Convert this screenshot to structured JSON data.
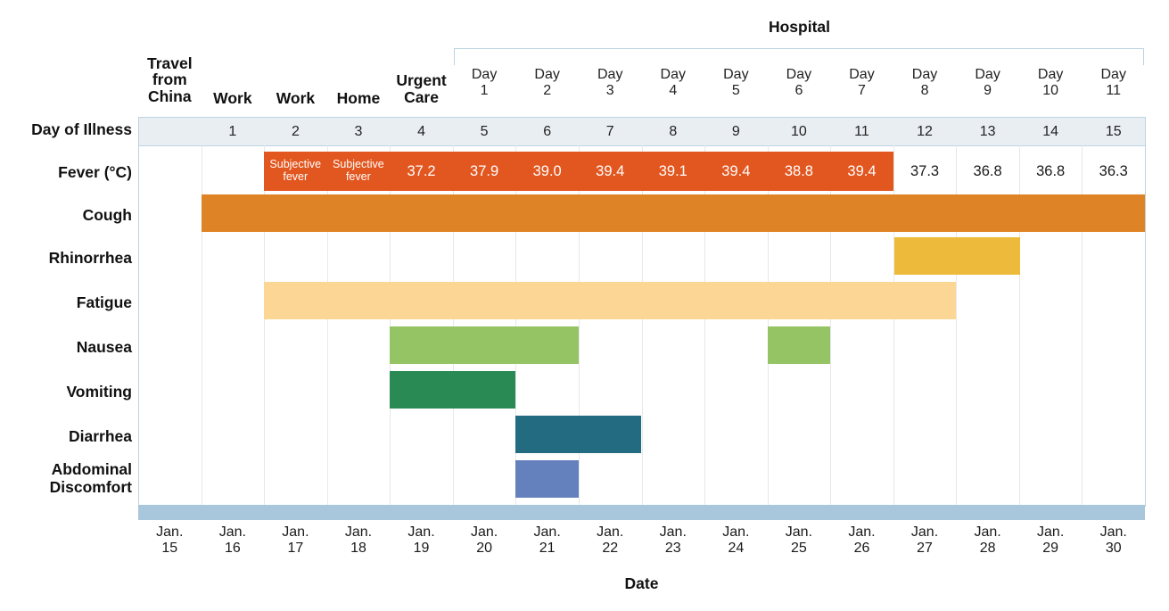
{
  "figure": {
    "hospital_label": "Hospital",
    "day_of_illness_label": "Day of Illness",
    "axis_title": "Date"
  },
  "setting_headers": [
    {
      "label": "Travel\nfrom\nChina",
      "col": 0
    },
    {
      "label": "Work",
      "col": 1
    },
    {
      "label": "Work",
      "col": 2
    },
    {
      "label": "Home",
      "col": 3
    },
    {
      "label": "Urgent\nCare",
      "col": 4
    }
  ],
  "hospital_days": [
    "Day\n1",
    "Day\n2",
    "Day\n3",
    "Day\n4",
    "Day\n5",
    "Day\n6",
    "Day\n7",
    "Day\n8",
    "Day\n9",
    "Day\n10",
    "Day\n11"
  ],
  "day_of_illness": [
    "",
    "1",
    "2",
    "3",
    "4",
    "5",
    "6",
    "7",
    "8",
    "9",
    "10",
    "11",
    "12",
    "13",
    "14",
    "15"
  ],
  "dates": [
    "Jan.\n15",
    "Jan.\n16",
    "Jan.\n17",
    "Jan.\n18",
    "Jan.\n19",
    "Jan.\n20",
    "Jan.\n21",
    "Jan.\n22",
    "Jan.\n23",
    "Jan.\n24",
    "Jan.\n25",
    "Jan.\n26",
    "Jan.\n27",
    "Jan.\n28",
    "Jan.\n29",
    "Jan.\n30"
  ],
  "row_labels": {
    "fever": "Fever (°C)",
    "cough": "Cough",
    "rhinorrhea": "Rhinorrhea",
    "fatigue": "Fatigue",
    "nausea": "Nausea",
    "vomiting": "Vomiting",
    "diarrhea": "Diarrhea",
    "abdominal": "Abdominal\nDiscomfort"
  },
  "colors": {
    "fever_bar": "#e2561f",
    "cough_bar": "#df8426",
    "rhinorrhea_bar": "#eeba3c",
    "fatigue_bar": "#fcd695",
    "nausea_bar": "#95c464",
    "vomiting_bar": "#2a8a54",
    "diarrhea_bar": "#226b80",
    "abdominal_bar": "#6481bd",
    "strip_blue": "#a8c6dc",
    "doi_strip": "#e9eef3",
    "rule": "#bcd3e2"
  },
  "chart_data": {
    "type": "table",
    "title": "Clinical course of illness by day",
    "xlabel": "Date",
    "ylabel": "",
    "categories": [
      "Jan. 15",
      "Jan. 16",
      "Jan. 17",
      "Jan. 18",
      "Jan. 19",
      "Jan. 20",
      "Jan. 21",
      "Jan. 22",
      "Jan. 23",
      "Jan. 24",
      "Jan. 25",
      "Jan. 26",
      "Jan. 27",
      "Jan. 28",
      "Jan. 29",
      "Jan. 30"
    ],
    "day_of_illness": [
      null,
      1,
      2,
      3,
      4,
      5,
      6,
      7,
      8,
      9,
      10,
      11,
      12,
      13,
      14,
      15
    ],
    "setting": [
      "Travel from China",
      "Work",
      "Work",
      "Home",
      "Urgent Care",
      "Hospital Day 1",
      "Hospital Day 2",
      "Hospital Day 3",
      "Hospital Day 4",
      "Hospital Day 5",
      "Hospital Day 6",
      "Hospital Day 7",
      "Hospital Day 8",
      "Hospital Day 9",
      "Hospital Day 10",
      "Hospital Day 11"
    ],
    "series": [
      {
        "name": "Fever (°C)",
        "values": [
          null,
          null,
          "Subjective fever",
          "Subjective fever",
          37.2,
          37.9,
          39.0,
          39.4,
          39.1,
          39.4,
          38.8,
          39.4,
          37.3,
          36.8,
          36.8,
          36.3
        ],
        "febrile_flag": [
          false,
          false,
          true,
          true,
          true,
          true,
          true,
          true,
          true,
          true,
          true,
          true,
          false,
          false,
          false,
          false
        ]
      },
      {
        "name": "Cough",
        "values": [
          0,
          1,
          1,
          1,
          1,
          1,
          1,
          1,
          1,
          1,
          1,
          1,
          1,
          1,
          1,
          1
        ]
      },
      {
        "name": "Rhinorrhea",
        "values": [
          0,
          0,
          0,
          0,
          0,
          0,
          0,
          0,
          0,
          0,
          0,
          0,
          1,
          1,
          0,
          0
        ]
      },
      {
        "name": "Fatigue",
        "values": [
          0,
          0,
          1,
          1,
          1,
          1,
          1,
          1,
          1,
          1,
          1,
          1,
          1,
          0,
          0,
          0
        ]
      },
      {
        "name": "Nausea",
        "values": [
          0,
          0,
          0,
          0,
          1,
          1,
          1,
          0,
          0,
          0,
          1,
          0,
          0,
          0,
          0,
          0
        ]
      },
      {
        "name": "Vomiting",
        "values": [
          0,
          0,
          0,
          0,
          1,
          1,
          0,
          0,
          0,
          0,
          0,
          0,
          0,
          0,
          0,
          0
        ]
      },
      {
        "name": "Diarrhea",
        "values": [
          0,
          0,
          0,
          0,
          0,
          0,
          1,
          1,
          0,
          0,
          0,
          0,
          0,
          0,
          0,
          0
        ]
      },
      {
        "name": "Abdominal Discomfort",
        "values": [
          0,
          0,
          0,
          0,
          0,
          0,
          1,
          0,
          0,
          0,
          0,
          0,
          0,
          0,
          0,
          0
        ]
      }
    ]
  }
}
